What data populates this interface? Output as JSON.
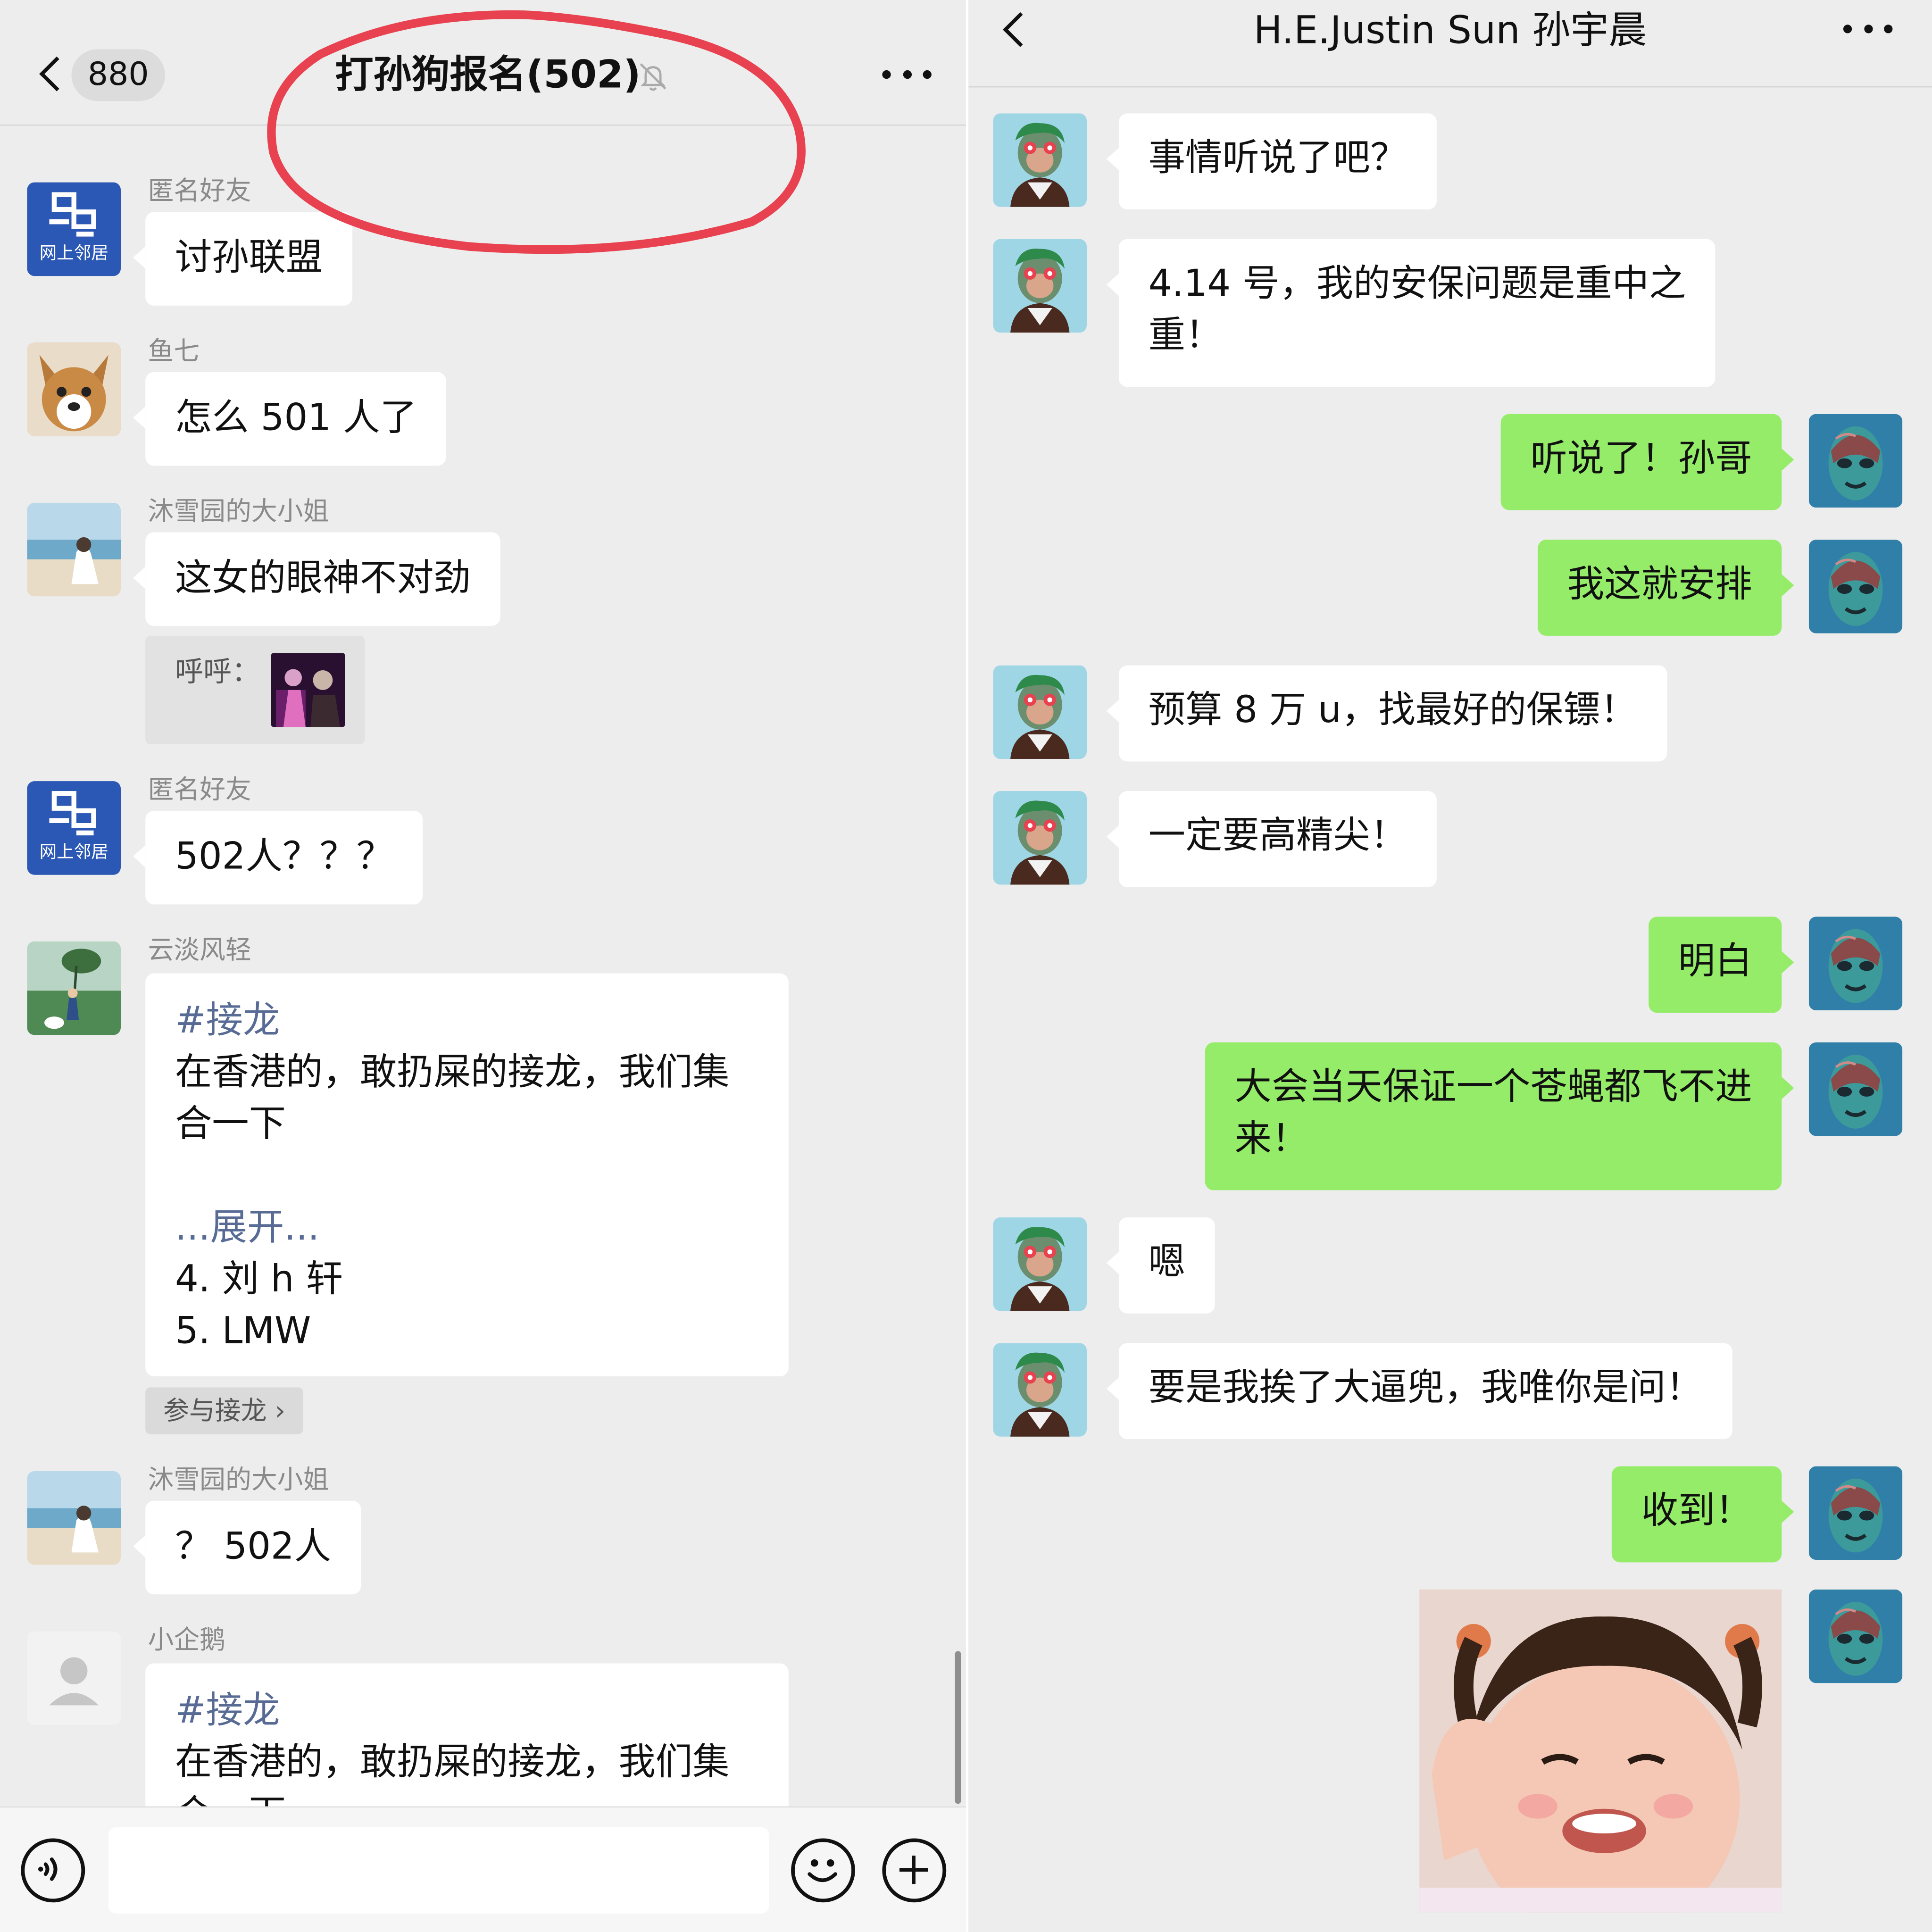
{
  "left_chat": {
    "header": {
      "unread_count": "880",
      "group_title": "打孙狗报名(502)"
    },
    "messages": [
      {
        "sender": "匿名好友",
        "text": [
          "讨孙联盟"
        ]
      },
      {
        "sender": "鱼七",
        "text": [
          "怎么 501 人了"
        ]
      },
      {
        "sender": "沐雪园的大小姐",
        "text": [
          "这女的眼神不对劲"
        ],
        "quote": {
          "label": "呼呼："
        }
      },
      {
        "sender": "匿名好友",
        "text": [
          "502人？？？"
        ]
      },
      {
        "sender": "云淡风轻",
        "hashtag": "#接龙",
        "text": [
          "在香港的，敢扔屎的接龙，我们集",
          "合一下"
        ],
        "expand": "...展开...",
        "items": [
          "4. 刘 h 轩",
          "5. LMW"
        ],
        "join_label": "参与接龙"
      },
      {
        "sender": "沐雪园的大小姐",
        "text": [
          "？ 502人"
        ]
      },
      {
        "sender": "小企鹅",
        "hashtag": "#接龙",
        "text": [
          "在香港的，敢扔屎的接龙，我们集",
          "合一下"
        ]
      }
    ],
    "avatar_caption": "网上邻居"
  },
  "right_chat": {
    "header": {
      "title": "H.E.Justin Sun 孙宇晨"
    },
    "messages": [
      {
        "from": "other",
        "text": [
          "事情听说了吧？"
        ]
      },
      {
        "from": "other",
        "text": [
          "4.14 号，我的安保问题是重中之",
          "重！"
        ]
      },
      {
        "from": "me",
        "text": [
          "听说了！孙哥"
        ]
      },
      {
        "from": "me",
        "text": [
          "我这就安排"
        ]
      },
      {
        "from": "other",
        "text": [
          "预算 8 万 u，找最好的保镖！"
        ]
      },
      {
        "from": "other",
        "text": [
          "一定要高精尖！"
        ]
      },
      {
        "from": "me",
        "text": [
          "明白"
        ]
      },
      {
        "from": "me",
        "text": [
          "大会当天保证一个苍蝇都飞不进",
          "来！"
        ]
      },
      {
        "from": "other",
        "text": [
          "嗯"
        ]
      },
      {
        "from": "other",
        "text": [
          "要是我挨了大逼兜，我唯你是问！"
        ]
      },
      {
        "from": "me",
        "text": [
          "收到！"
        ]
      },
      {
        "from": "me",
        "sticker": "smiling-child-sticker"
      }
    ]
  },
  "colors": {
    "background": "#ededed",
    "bubble_other": "#ffffff",
    "bubble_me": "#95ec69",
    "link": "#576b95",
    "annotation_circle": "#e8414f"
  },
  "icons": [
    "back-icon",
    "mute-bell-icon",
    "more-icon",
    "voice-icon",
    "emoji-icon",
    "plus-icon"
  ]
}
